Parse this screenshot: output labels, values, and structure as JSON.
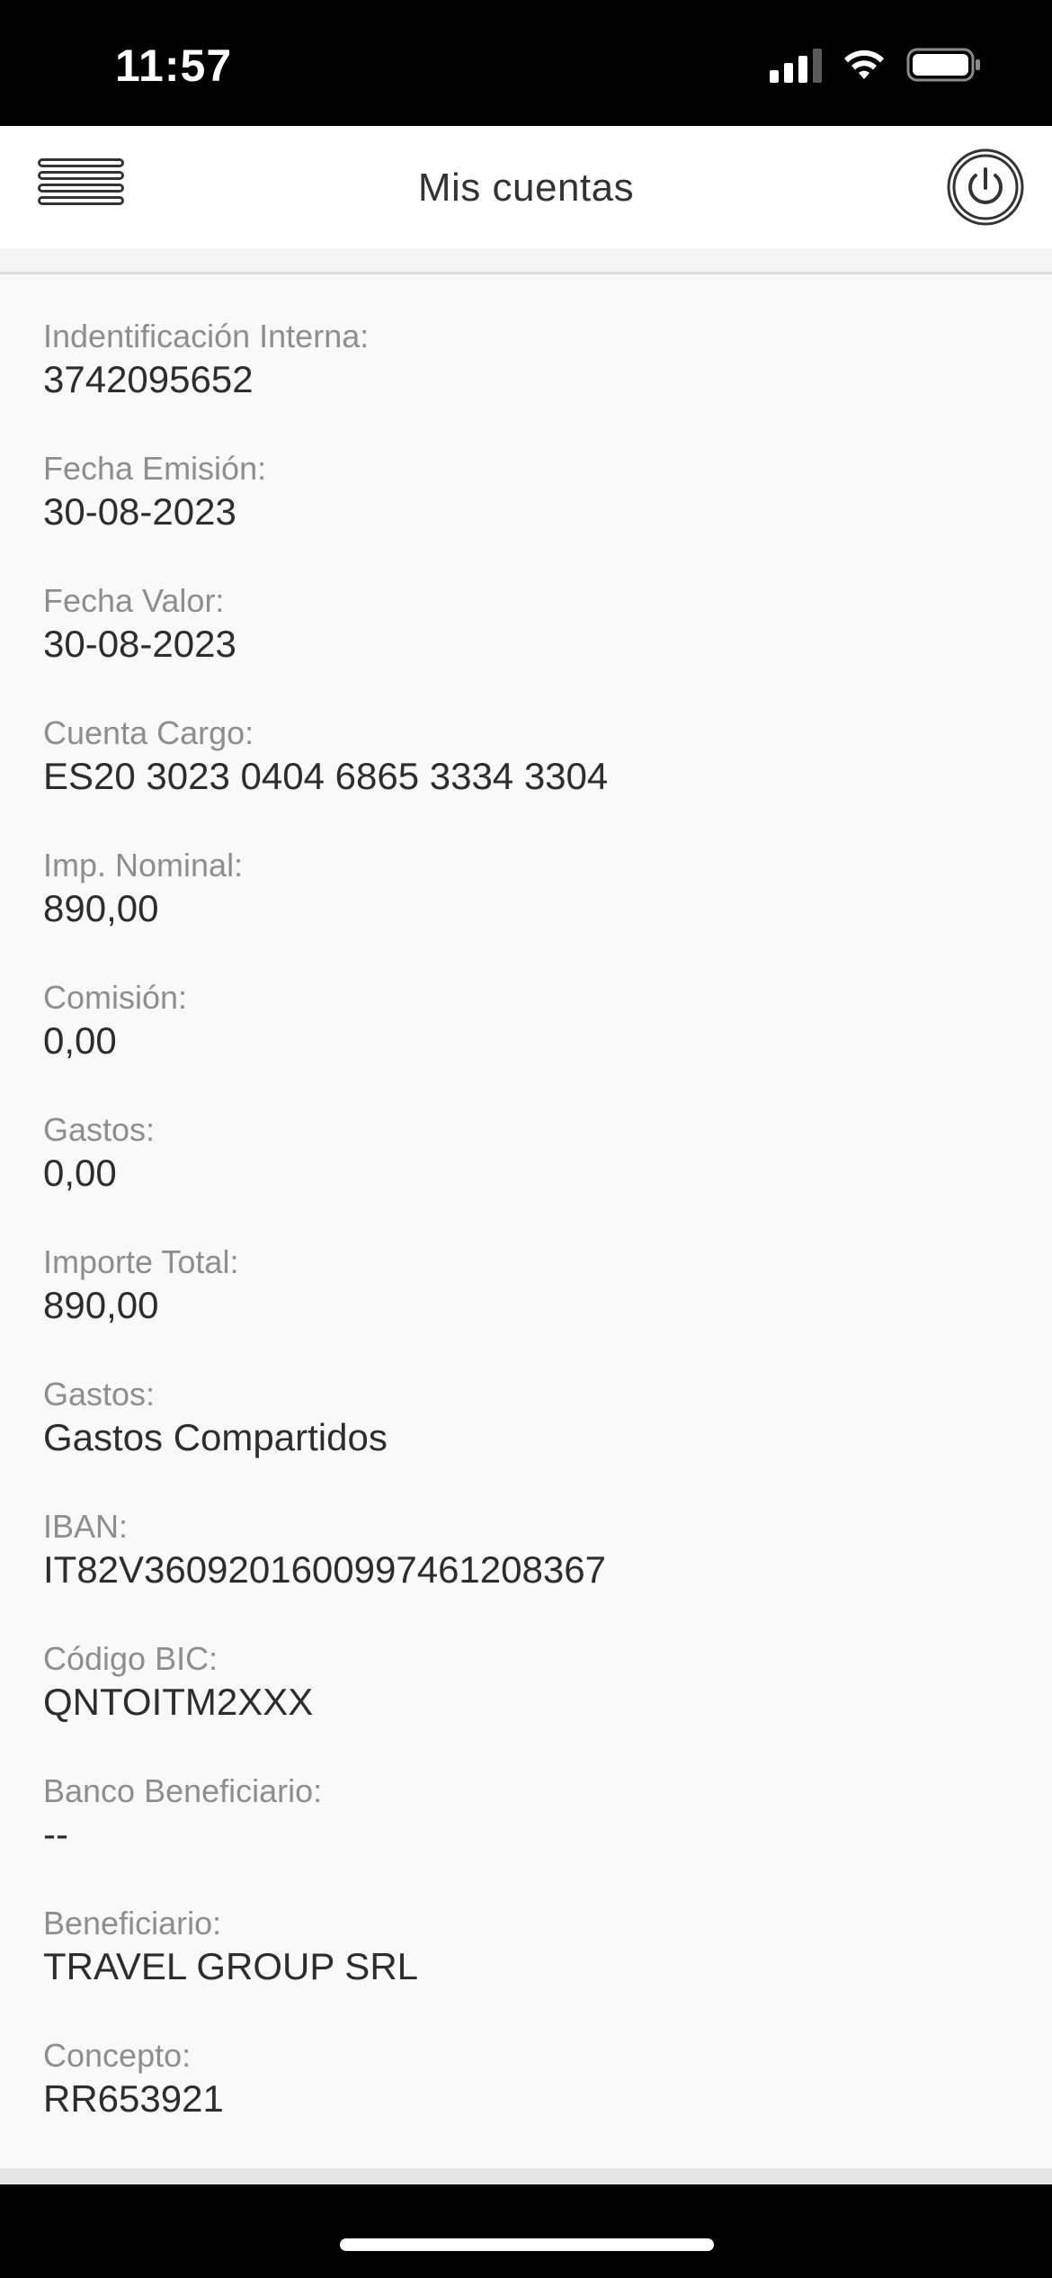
{
  "status_bar": {
    "time": "11:57",
    "icons": [
      "signal-icon",
      "wifi-icon",
      "battery-icon"
    ]
  },
  "header": {
    "title": "Mis cuentas",
    "menu_icon": "hamburger-menu-icon",
    "power_icon": "power-icon"
  },
  "fields": [
    {
      "label": "Indentificación Interna:",
      "value": "3742095652"
    },
    {
      "label": "Fecha Emisión:",
      "value": "30-08-2023"
    },
    {
      "label": "Fecha Valor:",
      "value": "30-08-2023"
    },
    {
      "label": "Cuenta Cargo:",
      "value": "ES20 3023 0404 6865 3334 3304"
    },
    {
      "label": "Imp. Nominal:",
      "value": "890,00"
    },
    {
      "label": "Comisión:",
      "value": "0,00"
    },
    {
      "label": "Gastos:",
      "value": "0,00"
    },
    {
      "label": "Importe Total:",
      "value": "890,00"
    },
    {
      "label": "Gastos:",
      "value": "Gastos Compartidos"
    },
    {
      "label": "IBAN:",
      "value": "IT82V3609201600997461208367"
    },
    {
      "label": "Código BIC:",
      "value": "QNTOITM2XXX"
    },
    {
      "label": "Banco Beneficiario:",
      "value": "--"
    },
    {
      "label": "Beneficiario:",
      "value": "TRAVEL GROUP SRL"
    },
    {
      "label": "Concepto:",
      "value": "RR653921"
    }
  ]
}
